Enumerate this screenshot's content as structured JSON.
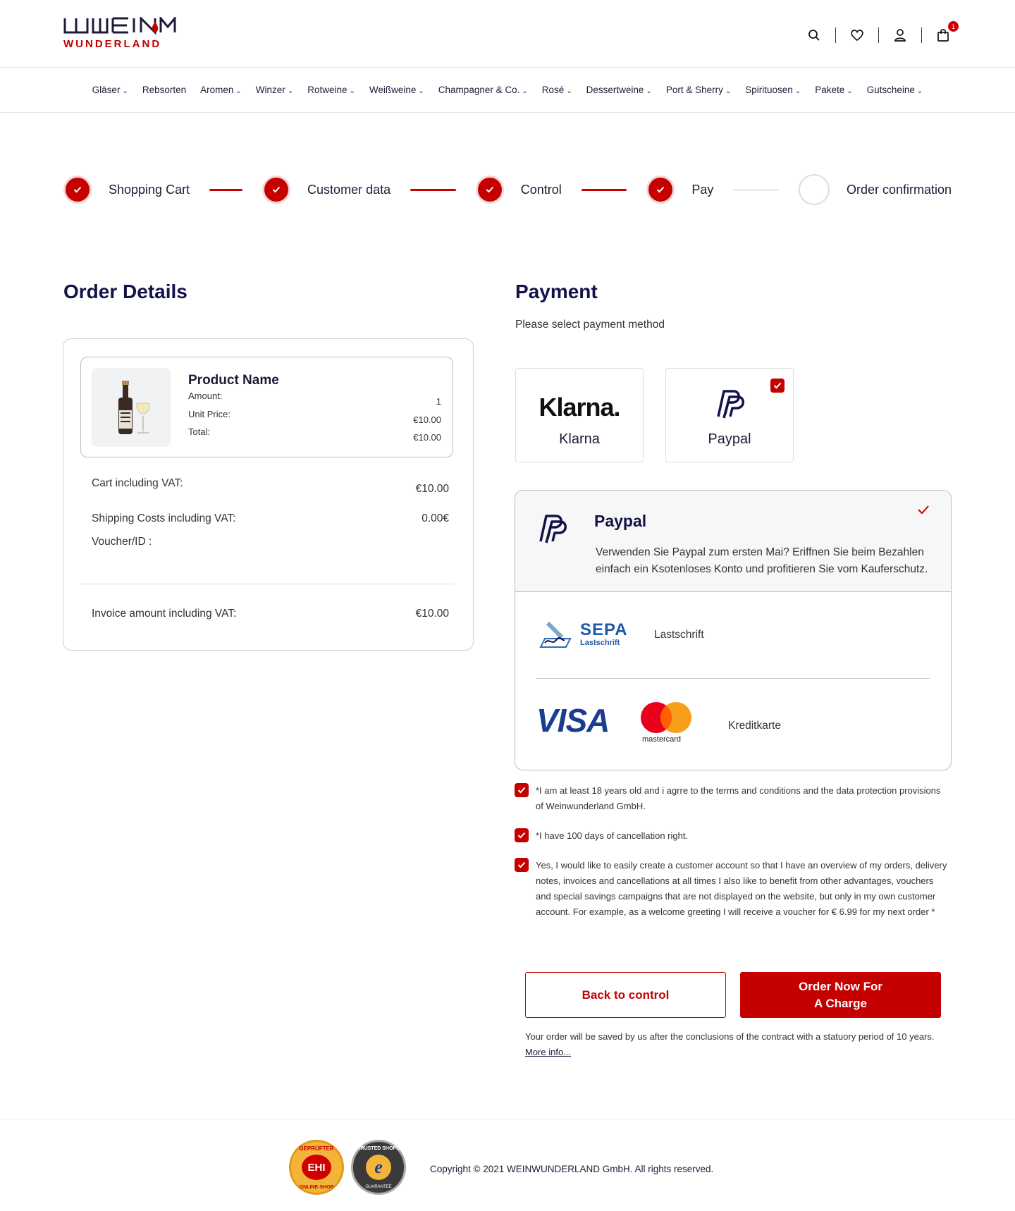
{
  "brand": {
    "top": "WEIN",
    "bottom": "WUNDERLAND",
    "color": "#c00000"
  },
  "header": {
    "cart_count": "1"
  },
  "nav": {
    "items": [
      {
        "label": "Gläser",
        "chev": true
      },
      {
        "label": "Rebsorten",
        "chev": false
      },
      {
        "label": "Aromen",
        "chev": true
      },
      {
        "label": "Winzer",
        "chev": true
      },
      {
        "label": "Rotweine",
        "chev": true
      },
      {
        "label": "Weißweine",
        "chev": true
      },
      {
        "label": "Champagner & Co.",
        "chev": true
      },
      {
        "label": "Rosé",
        "chev": true
      },
      {
        "label": "Dessertweine",
        "chev": true
      },
      {
        "label": "Port & Sherry",
        "chev": true
      },
      {
        "label": "Spirituosen",
        "chev": true
      },
      {
        "label": "Pakete",
        "chev": true
      },
      {
        "label": "Gutscheine",
        "chev": true
      }
    ],
    "chev_glyph": "⌄"
  },
  "stepper": {
    "steps": [
      {
        "label": "Shopping Cart",
        "done": true
      },
      {
        "label": "Customer data",
        "done": true
      },
      {
        "label": "Control",
        "done": true
      },
      {
        "label": "Pay",
        "done": true
      },
      {
        "label": "Order confirmation",
        "done": false
      }
    ]
  },
  "order": {
    "title": "Order Details",
    "product": {
      "name": "Product Name",
      "amount_label": "Amount:",
      "amount": "1",
      "unit_price_label": "Unit Price:",
      "unit_price": "€10.00",
      "total_label": "Total:",
      "total": "€10.00"
    },
    "cart_label": "Cart including VAT:",
    "cart_value": "€10.00",
    "shipping_label": "Shipping Costs including  VAT:",
    "shipping_value": "0.00€",
    "voucher_label": "Voucher/ID :",
    "invoice_label": "Invoice amount including VAT:",
    "invoice_value": "€10.00"
  },
  "payment": {
    "title": "Payment",
    "subtitle": "Please select payment method",
    "methods": [
      {
        "logo": "Klarna.",
        "label": "Klarna",
        "selected": false
      },
      {
        "logo": "paypal-icon",
        "label": "Paypal",
        "selected": true
      }
    ],
    "selected_panel": {
      "title": "Paypal",
      "desc": "Verwenden Sie Paypal zum ersten Mai? Eriffnen Sie beim Bezahlen einfach ein Ksotenloses Konto und profitieren Sie vom Kauferschutz."
    },
    "sepa": {
      "logo_title": "SEPA",
      "logo_sub": "Lastschrift",
      "label": "Lastschrift"
    },
    "card": {
      "visa": "VISA",
      "mastercard": "mastercard",
      "label": "Kreditkarte"
    }
  },
  "agreements": [
    "*I am at least 18 years old and i agrre to the terms and conditions and the data protection provisions  of Weinwunderland GmbH.",
    "*I have 100 days of cancellation right.",
    "Yes, I would like to easily create a customer account so that I have an overview of my orders, delivery notes, invoices and cancellations at all times I also like to benefit from other advantages, vouchers and special savings campaigns that are not displayed on the website, but only in my own customer account. For example, as a welcome greeting I will receive a voucher for € 6.99 for my next order *"
  ],
  "buttons": {
    "back": "Back to control",
    "order_line1": "Order Now For",
    "order_line2": "A Charge"
  },
  "note": {
    "text": "Your order will be saved by us after the conclusions of the contract with a statuory period of 10 years. ",
    "link": "More info..."
  },
  "footer": {
    "ehi_top": "GEPRÜFTER",
    "ehi_mid": "EHI",
    "ehi_bottom": "ONLINE-SHOP",
    "ts_top": "TRUSTED SHOPS",
    "ts_mid": "e",
    "ts_bottom": "GUARANTEE",
    "copyright": "Copyright © 2021 WEINWUNDERLAND GmbH. All rights reserved."
  },
  "colors": {
    "accent": "#c40000",
    "navy": "#13134a"
  }
}
